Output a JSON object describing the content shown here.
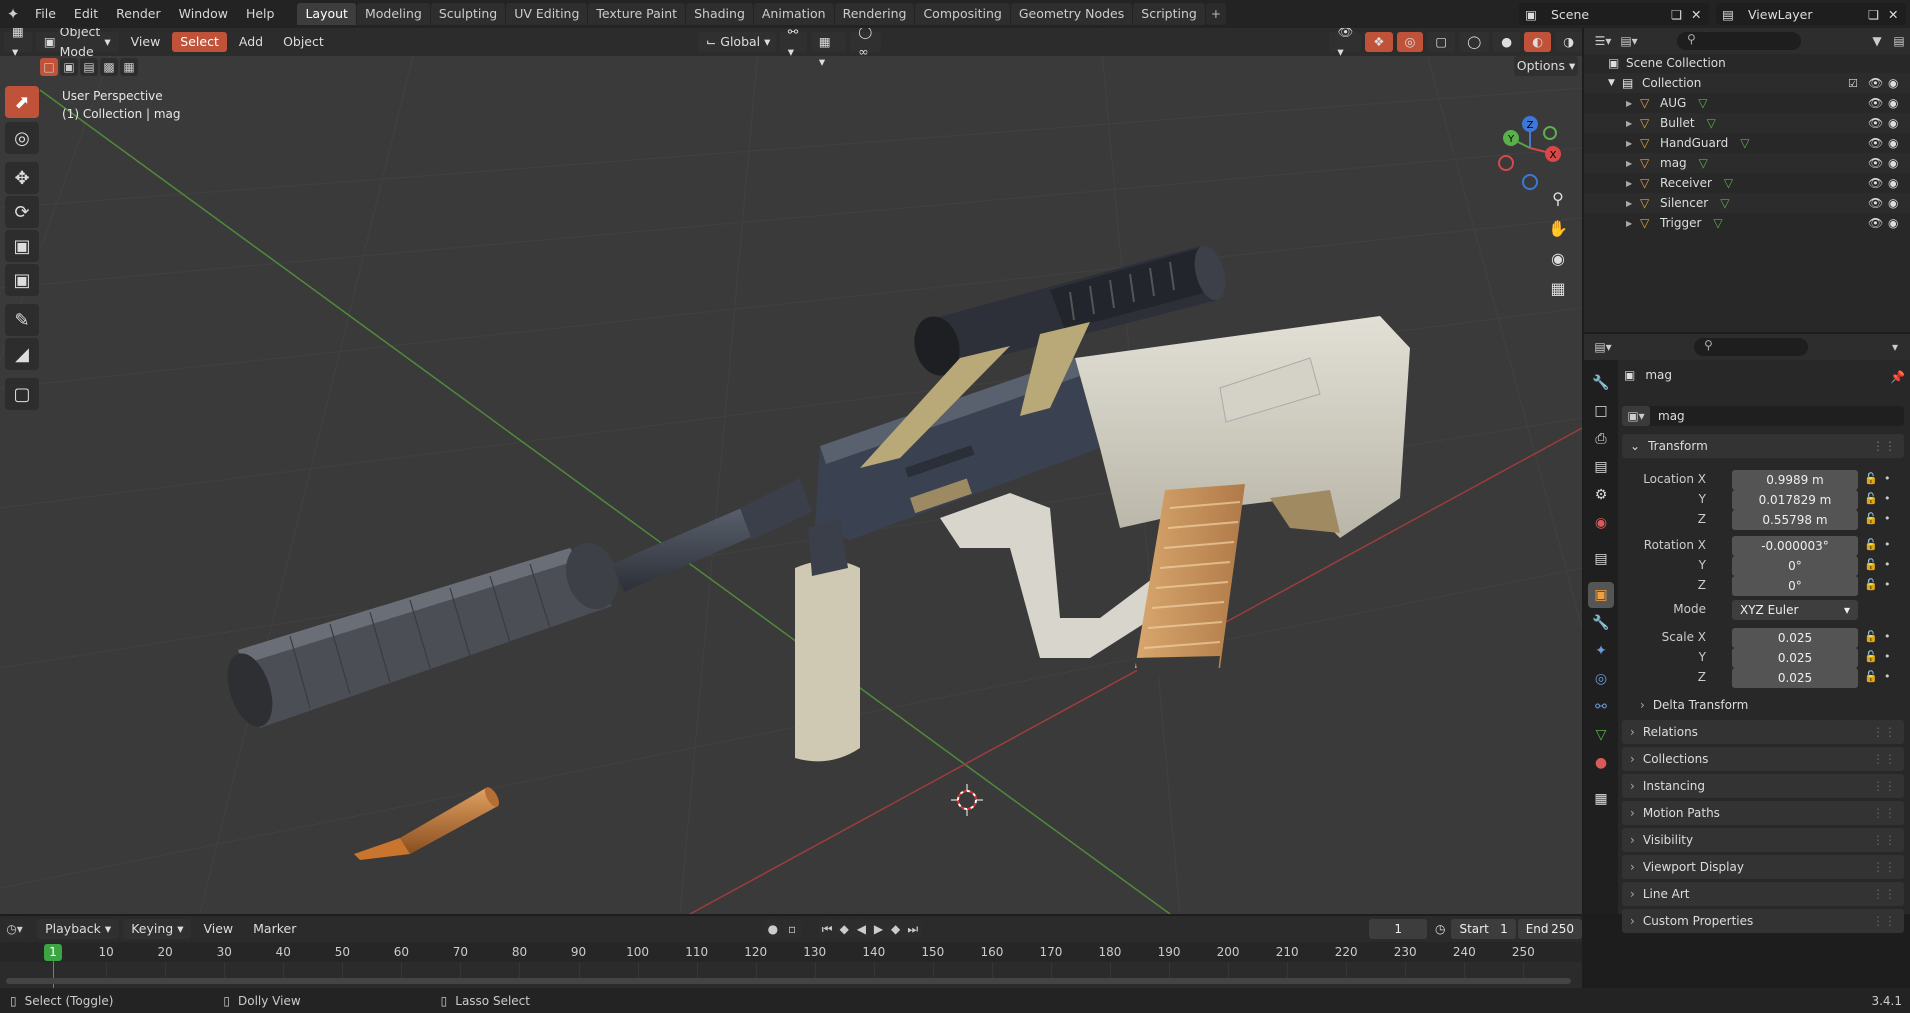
{
  "topbar": {
    "menus": [
      "File",
      "Edit",
      "Render",
      "Window",
      "Help"
    ],
    "workspaces": [
      "Layout",
      "Modeling",
      "Sculpting",
      "UV Editing",
      "Texture Paint",
      "Shading",
      "Animation",
      "Rendering",
      "Compositing",
      "Geometry Nodes",
      "Scripting"
    ],
    "active_workspace": "Layout",
    "scene": "Scene",
    "view_layer": "ViewLayer"
  },
  "viewport": {
    "mode": "Object Mode",
    "menus": [
      "View",
      "Select",
      "Add",
      "Object"
    ],
    "orientation": "Global",
    "options_label": "Options",
    "overlay_line1": "User Perspective",
    "overlay_line2": "(1) Collection | mag",
    "gizmo": {
      "x": "X",
      "y": "Y",
      "z": "Z"
    }
  },
  "outliner": {
    "root": "Scene Collection",
    "collection": "Collection",
    "objects": [
      "AUG",
      "Bullet",
      "HandGuard",
      "mag",
      "Receiver",
      "Silencer",
      "Trigger"
    ],
    "selected": "mag"
  },
  "properties": {
    "object_name": "mag",
    "data_name": "mag",
    "transform_label": "Transform",
    "location_label": "Location X",
    "location": {
      "x": "0.9989 m",
      "y": "0.017829 m",
      "z": "0.55798 m"
    },
    "rotation_label": "Rotation X",
    "rotation": {
      "x": "-0.000003°",
      "y": "0°",
      "z": "0°"
    },
    "mode_label": "Mode",
    "mode_value": "XYZ Euler",
    "scale_label": "Scale X",
    "scale": {
      "x": "0.025",
      "y": "0.025",
      "z": "0.025"
    },
    "y_label": "Y",
    "z_label": "Z",
    "delta": "Delta Transform",
    "panels": [
      "Relations",
      "Collections",
      "Instancing",
      "Motion Paths",
      "Visibility",
      "Viewport Display",
      "Line Art",
      "Custom Properties"
    ]
  },
  "timeline": {
    "menus": [
      "Playback",
      "Keying",
      "View",
      "Marker"
    ],
    "current_frame": "1",
    "start_label": "Start",
    "start": "1",
    "end_label": "End",
    "end": "250",
    "ticks": [
      "10",
      "20",
      "30",
      "40",
      "50",
      "60",
      "70",
      "80",
      "90",
      "100",
      "110",
      "120",
      "130",
      "140",
      "150",
      "160",
      "170",
      "180",
      "190",
      "200",
      "210",
      "220",
      "230",
      "240",
      "250"
    ],
    "playhead": "1"
  },
  "statusbar": {
    "select": "Select (Toggle)",
    "dolly": "Dolly View",
    "lasso": "Lasso Select",
    "version": "3.4.1"
  },
  "colors": {
    "accent": "#c0523a",
    "selected_row": "#334d80",
    "frame_marker": "#3da443"
  }
}
